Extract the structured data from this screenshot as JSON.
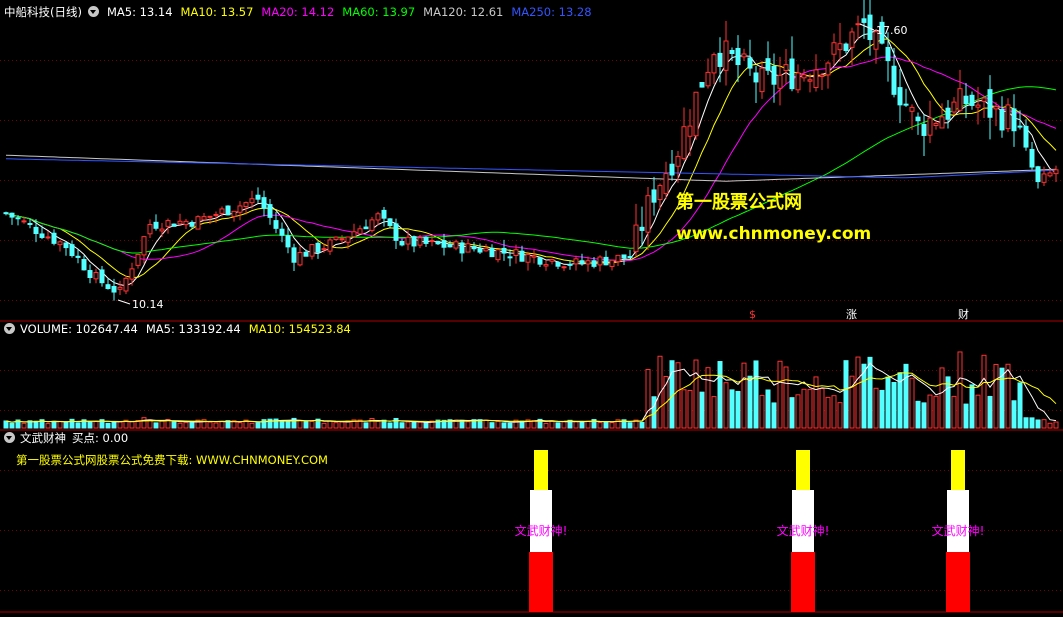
{
  "header": {
    "stock_name": "中船科技(日线)",
    "ma_items": [
      {
        "label": "MA5: 13.14",
        "color": "#ffffff"
      },
      {
        "label": "MA10: 13.57",
        "color": "#ffff00"
      },
      {
        "label": "MA20: 14.12",
        "color": "#ff00ff"
      },
      {
        "label": "MA60: 13.97",
        "color": "#00ff00"
      },
      {
        "label": "MA120: 12.61",
        "color": "#c8c8c8"
      },
      {
        "label": "MA250: 13.28",
        "color": "#3355ff"
      }
    ]
  },
  "volume": {
    "title": "VOLUME: 102647.44",
    "ma5": "MA5: 133192.44",
    "ma10": "MA10: 154523.84"
  },
  "indicator": {
    "title": "文武财神",
    "buy_point": "买点: 0.00",
    "ad_text": "第一股票公式网股票公式免费下载: WWW.CHNMONEY.COM",
    "signal_label": "文武财神!"
  },
  "annotations": {
    "high": "17.60",
    "low": "10.14",
    "event_s": "$",
    "event_zhang": "涨",
    "event_cai": "财"
  },
  "watermark": {
    "line1": "第一股票公式网",
    "line2": "www.chnmoney.com"
  },
  "colors": {
    "up": "#ff3232",
    "down": "#54ffff",
    "grid": "#8b0000",
    "signal_yellow": "#ffff00",
    "signal_white": "#ffffff",
    "signal_red": "#ff0000"
  }
}
